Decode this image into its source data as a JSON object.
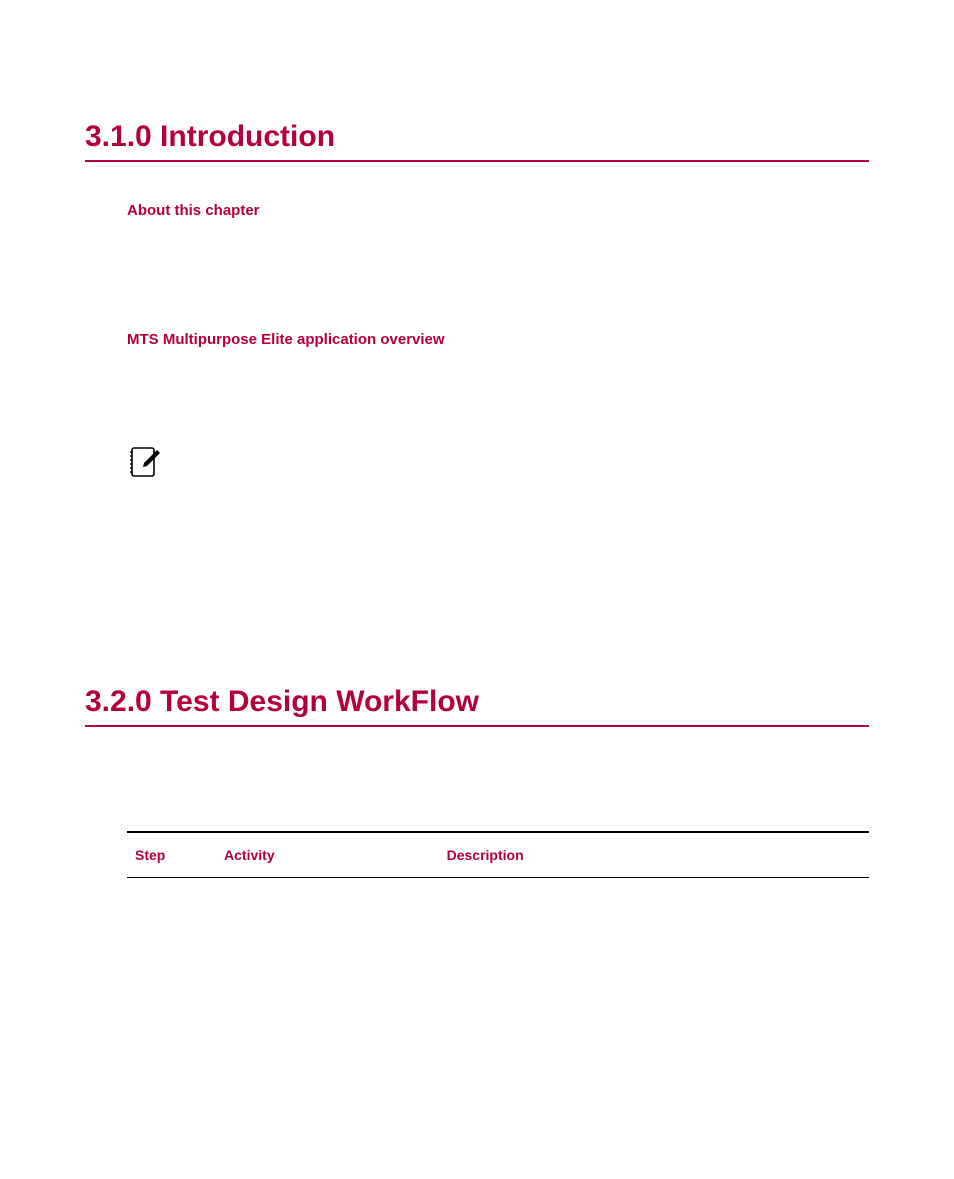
{
  "section1": {
    "heading": "3.1.0 Introduction",
    "sub1": "About this chapter",
    "sub2": "MTS Multipurpose Elite application overview"
  },
  "section2": {
    "heading": "3.2.0 Test Design WorkFlow",
    "table": {
      "headers": {
        "step": "Step",
        "activity": "Activity",
        "description": "Description"
      }
    }
  }
}
